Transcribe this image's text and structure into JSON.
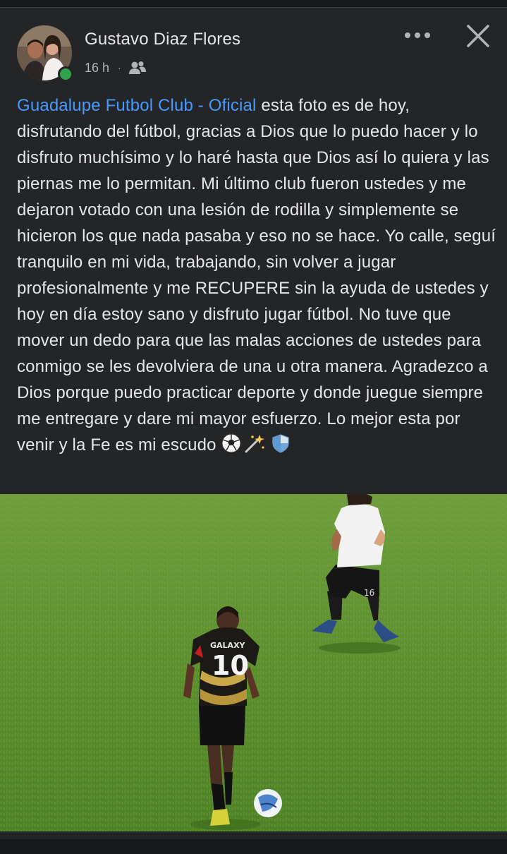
{
  "post": {
    "author": "Gustavo Diaz Flores",
    "time": "16 h",
    "separator": "·",
    "audience_icon": "friends-icon",
    "mention": "Guadalupe Futbol Club - Oficial",
    "body": " esta foto es de hoy, disfrutando del fútbol, gracias a Dios que lo puedo hacer y lo disfruto muchísimo y lo haré hasta que Dios así lo quiera y las piernas me lo permitan. Mi último club fueron ustedes y me dejaron votado con una lesión de rodilla y simplemente se hicieron los que nada pasaba y eso no se hace. Yo calle, seguí tranquilo en mi vida, trabajando, sin volver a jugar profesionalmente y me RECUPERE sin la ayuda de ustedes y hoy en día estoy sano y disfruto jugar fútbol. No tuve que mover un dedo para que las malas acciones de ustedes para conmigo se les devolviera de una u otra manera. Agradezco a Dios porque puedo practicar deporte y donde juegue siempre me entregare y dare mi mayor esfuerzo. Lo mejor esta por venir y la Fe es mi escudo ",
    "emojis": [
      "soccer-ball-emoji",
      "sparkles-emoji",
      "shield-emoji"
    ],
    "photo": {
      "player_front_number": "10",
      "player_front_shirt_text": "GALAXY",
      "player_back_number": "16"
    }
  },
  "actions": {
    "more_icon": "more-icon",
    "close_icon": "close-icon"
  },
  "colors": {
    "background": "#242526",
    "text": "#e4e6eb",
    "secondary_text": "#b0b3b8",
    "mention": "#4599ff",
    "online": "#31a24c"
  }
}
